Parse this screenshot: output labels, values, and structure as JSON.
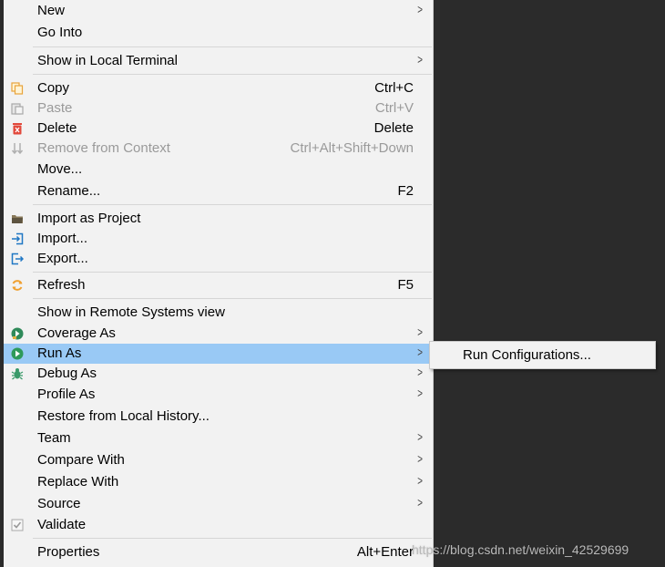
{
  "menu": {
    "new": {
      "label": "New"
    },
    "go_into": {
      "label": "Go Into"
    },
    "show_in_local_terminal": {
      "label": "Show in Local Terminal"
    },
    "copy": {
      "label": "Copy",
      "shortcut": "Ctrl+C",
      "icon": "copy-icon"
    },
    "paste": {
      "label": "Paste",
      "shortcut": "Ctrl+V",
      "icon": "paste-icon"
    },
    "delete": {
      "label": "Delete",
      "shortcut": "Delete",
      "icon": "delete-icon"
    },
    "remove_from_context": {
      "label": "Remove from Context",
      "shortcut": "Ctrl+Alt+Shift+Down",
      "icon": "remove-context-icon"
    },
    "move": {
      "label": "Move..."
    },
    "rename": {
      "label": "Rename...",
      "shortcut": "F2"
    },
    "import_as_project": {
      "label": "Import as Project",
      "icon": "folder-icon"
    },
    "import": {
      "label": "Import...",
      "icon": "import-icon"
    },
    "export": {
      "label": "Export...",
      "icon": "export-icon"
    },
    "refresh": {
      "label": "Refresh",
      "shortcut": "F5",
      "icon": "refresh-icon"
    },
    "show_remote": {
      "label": "Show in Remote Systems view"
    },
    "coverage_as": {
      "label": "Coverage As",
      "icon": "coverage-icon"
    },
    "run_as": {
      "label": "Run As",
      "icon": "run-icon"
    },
    "debug_as": {
      "label": "Debug As",
      "icon": "debug-icon"
    },
    "profile_as": {
      "label": "Profile As"
    },
    "restore_history": {
      "label": "Restore from Local History..."
    },
    "team": {
      "label": "Team"
    },
    "compare_with": {
      "label": "Compare With"
    },
    "replace_with": {
      "label": "Replace With"
    },
    "source": {
      "label": "Source"
    },
    "validate": {
      "label": "Validate",
      "icon": "checkbox-icon"
    },
    "properties": {
      "label": "Properties",
      "shortcut": "Alt+Enter"
    }
  },
  "submenu": {
    "run_configurations": {
      "label": "Run Configurations..."
    }
  },
  "watermark": "https://blog.csdn.net/weixin_42529699",
  "colors": {
    "menu_bg": "#f2f2f2",
    "highlight": "#99c9f5",
    "disabled_text": "#9a9a9a",
    "background": "#2b2b2b"
  }
}
